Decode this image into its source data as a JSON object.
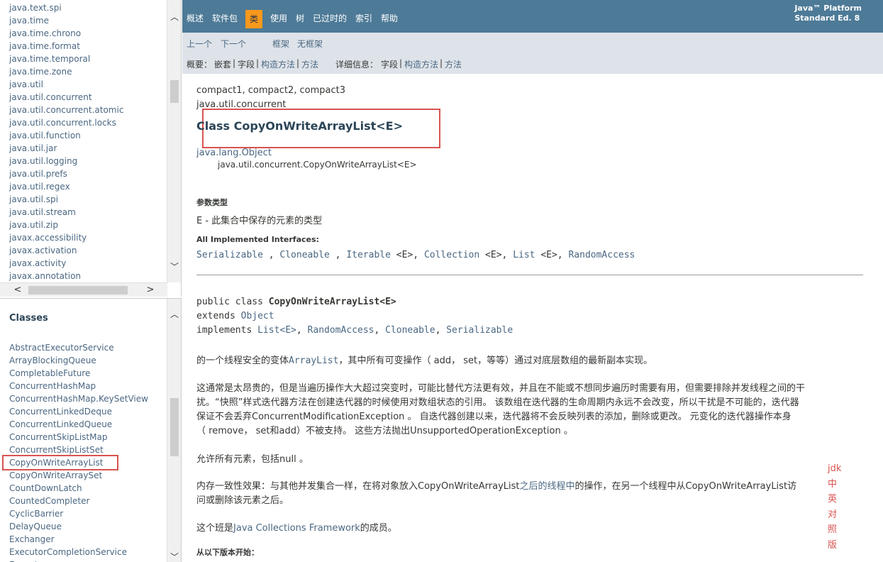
{
  "packages": [
    "java.text.spi",
    "java.time",
    "java.time.chrono",
    "java.time.format",
    "java.time.temporal",
    "java.time.zone",
    "java.util",
    "java.util.concurrent",
    "java.util.concurrent.atomic",
    "java.util.concurrent.locks",
    "java.util.function",
    "java.util.jar",
    "java.util.logging",
    "java.util.prefs",
    "java.util.regex",
    "java.util.spi",
    "java.util.stream",
    "java.util.zip",
    "javax.accessibility",
    "javax.activation",
    "javax.activity",
    "javax.annotation"
  ],
  "classes_title": "Classes",
  "classes": [
    "AbstractExecutorService",
    "ArrayBlockingQueue",
    "CompletableFuture",
    "ConcurrentHashMap",
    "ConcurrentHashMap.KeySetView",
    "ConcurrentLinkedDeque",
    "ConcurrentLinkedQueue",
    "ConcurrentSkipListMap",
    "ConcurrentSkipListSet",
    "CopyOnWriteArrayList",
    "CopyOnWriteArraySet",
    "CountDownLatch",
    "CountedCompleter",
    "CyclicBarrier",
    "DelayQueue",
    "Exchanger",
    "ExecutorCompletionService",
    "Executors"
  ],
  "nav": {
    "overview": "概述",
    "package": "软件包",
    "class": "类",
    "use": "使用",
    "tree": "树",
    "deprecated": "已过时的",
    "index": "索引",
    "help": "帮助",
    "platform_line1": "Java™ Platform",
    "platform_line2": "Standard Ed. 8"
  },
  "subnav": {
    "prev": "上一个",
    "next": "下一个",
    "frames": "框架",
    "noframes": "无框架",
    "summary_label": "概要：",
    "summary_nested": "嵌套",
    "summary_field": "字段",
    "summary_constr": "构造方法",
    "summary_method": "方法",
    "detail_label": "详细信息：",
    "detail_field": "字段",
    "detail_constr": "构造方法",
    "detail_method": "方法",
    "sep": "|"
  },
  "doc": {
    "profiles": "compact1, compact2, compact3",
    "package": "java.util.concurrent",
    "class_title": "Class CopyOnWriteArrayList<E>",
    "inherit1": "java.lang.Object",
    "inherit2": "java.util.concurrent.CopyOnWriteArrayList<E>",
    "type_params_label": "参数类型",
    "type_param": "E - 此集合中保存的元素的类型",
    "impl_label": "All Implemented Interfaces:",
    "interfaces": [
      {
        "name": "Serializable",
        "suffix": " ,"
      },
      {
        "name": "Cloneable",
        "suffix": " ,"
      },
      {
        "name": "Iterable",
        "suffix": " <E>,"
      },
      {
        "name": "Collection",
        "suffix": " <E>,"
      },
      {
        "name": "List",
        "suffix": " <E>,"
      },
      {
        "name": "RandomAccess",
        "suffix": ""
      }
    ],
    "decl_public": "public class ",
    "decl_name": "CopyOnWriteArrayList<E>",
    "decl_extends": "extends ",
    "decl_object": "Object",
    "decl_implements": "implements ",
    "decl_list": "List<E>",
    "decl_comma1": ", ",
    "decl_ra": "RandomAccess",
    "decl_comma2": ", ",
    "decl_clone": "Cloneable",
    "decl_comma3": ", ",
    "decl_ser": "Serializable",
    "p1_a": "的一个线程安全的变体",
    "p1_link": "ArrayList",
    "p1_b": "，其中所有可变操作（ add， set，等等）通过对底层数组的最新副本实现。",
    "p2_l1": "这通常是太昂贵的，但是当遍历操作大大超过突变时，可能比替代方法更有效，并且在不能或不想同步遍历时需要有用，但需要排除并发线程之间的干",
    "p2_l2": "扰。“快照”样式迭代器方法在创建迭代器的时候使用对数组状态的引用。 该数组在迭代器的生命周期内永远不会改变，所以干扰是不可能的，迭代器",
    "p2_l3": "保证不会丢弃ConcurrentModificationException 。 自迭代器创建以来，迭代器将不会反映列表的添加，删除或更改。 元变化的迭代器操作本身",
    "p2_l4": "（ remove， set和add）不被支持。 这些方法抛出UnsupportedOperationException 。",
    "p3": "允许所有元素，包括null 。",
    "p4_l1a": "内存一致性效果：与其他并发集合一样，在将对象放入CopyOnWriteArrayList",
    "p4_l1link": "之后的线程中",
    "p4_l1b": "的操作，在另一个线程中从CopyOnWriteArrayList访",
    "p4_l2": "问或删除该元素之后。",
    "p5_a": "这个班是",
    "p5_link": "Java Collections Framework",
    "p5_b": "的成员。",
    "since_label": "从以下版本开始："
  },
  "annotation": [
    "jdk",
    "中",
    "英",
    "对",
    "照",
    "版"
  ]
}
